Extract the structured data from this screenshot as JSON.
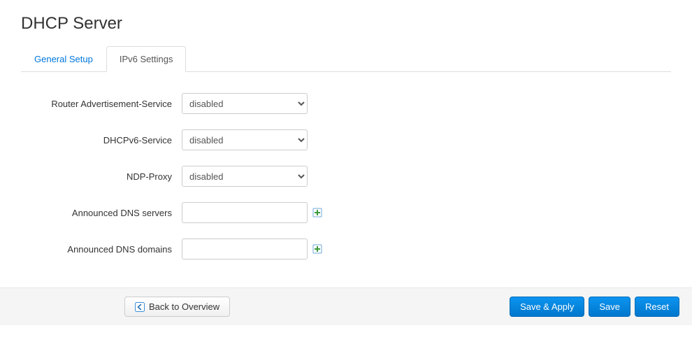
{
  "page": {
    "title": "DHCP Server"
  },
  "tabs": {
    "general": "General Setup",
    "ipv6": "IPv6 Settings"
  },
  "form": {
    "ra": {
      "label": "Router Advertisement-Service",
      "value": "disabled"
    },
    "dhcpv6": {
      "label": "DHCPv6-Service",
      "value": "disabled"
    },
    "ndp": {
      "label": "NDP-Proxy",
      "value": "disabled"
    },
    "dns_servers": {
      "label": "Announced DNS servers",
      "value": ""
    },
    "dns_domains": {
      "label": "Announced DNS domains",
      "value": ""
    }
  },
  "footer": {
    "back": "Back to Overview",
    "save_apply": "Save & Apply",
    "save": "Save",
    "reset": "Reset"
  }
}
